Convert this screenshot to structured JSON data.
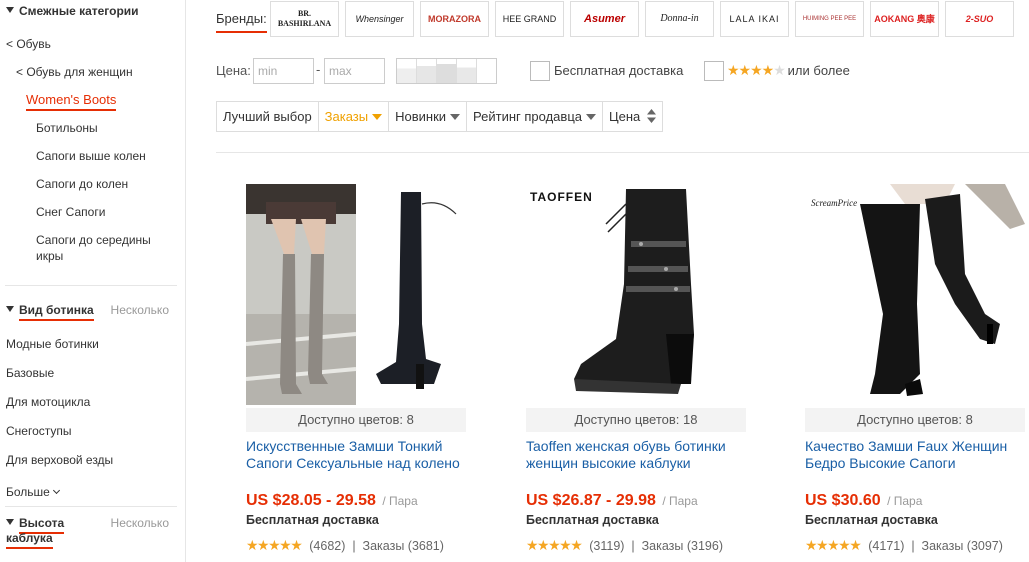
{
  "sidebar": {
    "related_title": "Смежные категории",
    "breadcrumbs": [
      "< Обувь",
      "< Обувь для женщин"
    ],
    "active": "Women's Boots",
    "subcats": [
      "Ботильоны",
      "Сапоги выше колен",
      "Сапоги до колен",
      "Снег Сапоги",
      "Сапоги до середины икры"
    ],
    "boot_type": {
      "title": "Вид ботинка",
      "hint": "Несколько",
      "items": [
        "Модные ботинки",
        "Базовые",
        "Для мотоцикла",
        "Снегоступы",
        "Для верховой езды"
      ],
      "more": "Больше"
    },
    "heel": {
      "title": "Высота каблука",
      "hint": "Несколько"
    }
  },
  "brands": {
    "label": "Бренды:",
    "items": [
      "BR. BASHIRLANA",
      "Whensinger",
      "MORAZORA",
      "HEE GRAND",
      "Asumer",
      "Donna-in",
      "LALA IKAI",
      "HUIMING PEE PEE",
      "AOKANG 奥康",
      "2-SUO"
    ]
  },
  "filters": {
    "price_label": "Цена:",
    "min_placeholder": "min",
    "max_placeholder": "max",
    "dash": "-",
    "free_shipping": "Бесплатная доставка",
    "rating_suffix": "или более",
    "rating_stars": 4
  },
  "sort": {
    "items": [
      "Лучший выбор",
      "Заказы",
      "Новинки",
      "Рейтинг продавца",
      "Цена"
    ],
    "active_index": 1
  },
  "products": [
    {
      "colors": "Доступно цветов: 8",
      "title": "Искусственные Замши Тонкий Сапоги Сексуальные над колено",
      "price": "US $28.05 - 29.58",
      "unit": "/ Пара",
      "shipping": "Бесплатная доставка",
      "reviews": "(4682)",
      "orders": "Заказы (3681)"
    },
    {
      "colors": "Доступно цветов: 18",
      "title": "Taoffen женская обувь ботинки женщин высокие каблуки",
      "price": "US $26.87 - 29.98",
      "unit": "/ Пара",
      "shipping": "Бесплатная доставка",
      "reviews": "(3119)",
      "orders": "Заказы (3196)",
      "logo": "TAOFFEN"
    },
    {
      "colors": "Доступно цветов: 8",
      "title": "Качество Замши Faux Женщин Бедро Высокие Сапоги",
      "price": "US $30.60",
      "unit": "/ Пара",
      "shipping": "Бесплатная доставка",
      "reviews": "(4171)",
      "orders": "Заказы (3097)",
      "logo": "ScreamPrice"
    }
  ],
  "colors": {
    "accent": "#e62e04",
    "link": "#1a5fa6",
    "star": "#f5a623",
    "sort_active": "#f0a100"
  }
}
